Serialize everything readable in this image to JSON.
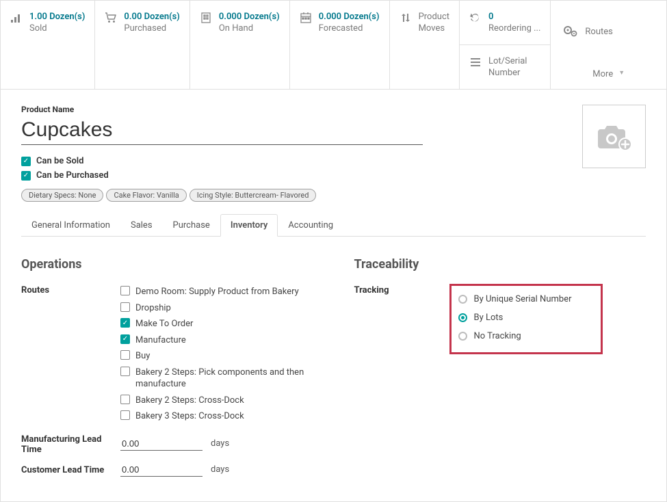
{
  "stats": {
    "sold": {
      "value": "1.00 Dozen(s)",
      "label": "Sold"
    },
    "purchased": {
      "value": "0.00 Dozen(s)",
      "label": "Purchased"
    },
    "on_hand": {
      "value": "0.000 Dozen(s)",
      "label": "On Hand"
    },
    "forecasted": {
      "value": "0.000 Dozen(s)",
      "label": "Forecasted"
    },
    "moves": {
      "label": "Product Moves"
    },
    "reordering": {
      "value": "0",
      "label": "Reordering ..."
    },
    "lot_serial": {
      "label": "Lot/Serial Number"
    }
  },
  "routes_label": "Routes",
  "more_label": "More",
  "product_name_label": "Product Name",
  "product_name": "Cupcakes",
  "can_be_sold_label": "Can be Sold",
  "can_be_purchased_label": "Can be Purchased",
  "tags": [
    "Dietary Specs: None",
    "Cake Flavor: Vanilla",
    "Icing Style: Buttercream- Flavored"
  ],
  "tabs": {
    "general": "General Information",
    "sales": "Sales",
    "purchase": "Purchase",
    "inventory": "Inventory",
    "accounting": "Accounting"
  },
  "operations": {
    "title": "Operations",
    "routes_label": "Routes",
    "routes": [
      {
        "label": "Demo Room: Supply Product from Bakery",
        "checked": false
      },
      {
        "label": "Dropship",
        "checked": false
      },
      {
        "label": "Make To Order",
        "checked": true
      },
      {
        "label": "Manufacture",
        "checked": true
      },
      {
        "label": "Buy",
        "checked": false
      },
      {
        "label": "Bakery 2 Steps: Pick components and then manufacture",
        "checked": false
      },
      {
        "label": "Bakery 2 Steps: Cross-Dock",
        "checked": false
      },
      {
        "label": "Bakery 3 Steps: Cross-Dock",
        "checked": false
      }
    ],
    "mfg_lead_label": "Manufacturing Lead Time",
    "mfg_lead_value": "0.00",
    "mfg_lead_unit": "days",
    "cust_lead_label": "Customer Lead Time",
    "cust_lead_value": "0.00",
    "cust_lead_unit": "days"
  },
  "traceability": {
    "title": "Traceability",
    "tracking_label": "Tracking",
    "options": [
      {
        "label": "By Unique Serial Number",
        "checked": false
      },
      {
        "label": "By Lots",
        "checked": true
      },
      {
        "label": "No Tracking",
        "checked": false
      }
    ]
  }
}
